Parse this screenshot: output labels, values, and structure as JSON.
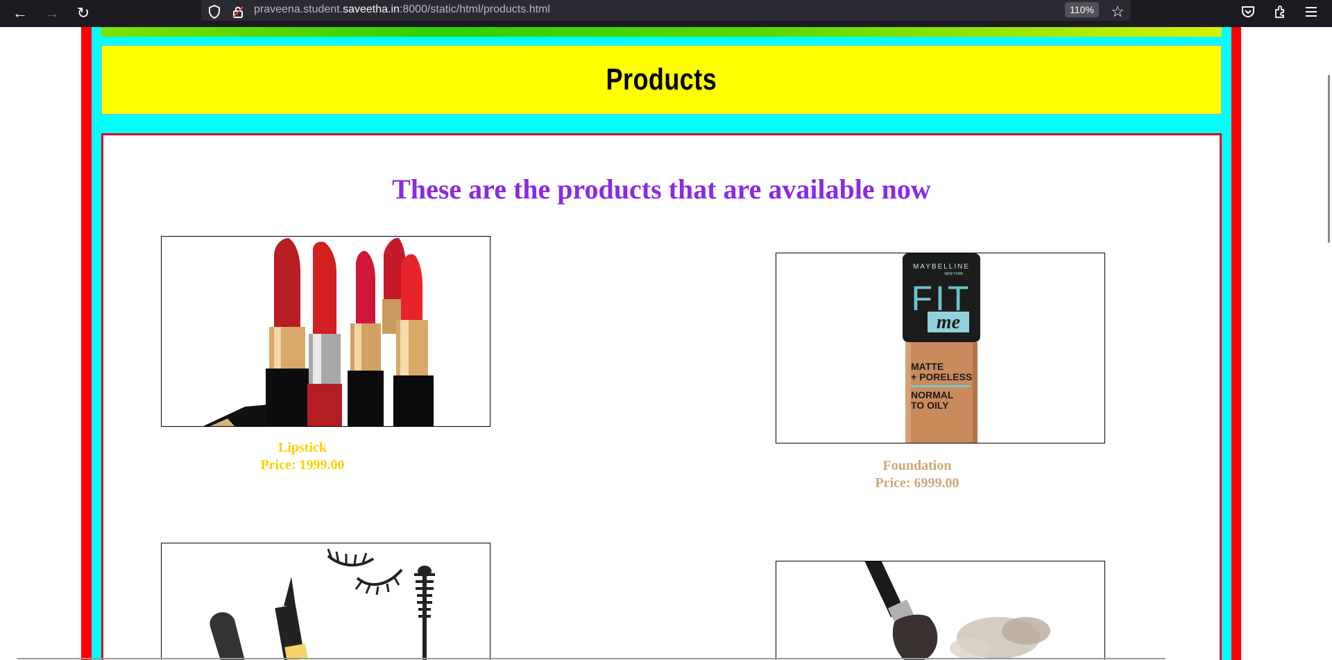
{
  "browser": {
    "url_prefix": "praveena.student.",
    "url_domain": "saveetha.in",
    "url_suffix": ":8000/static/html/products.html",
    "zoom": "110%"
  },
  "page": {
    "title": "Products",
    "subtitle": "These are the products that are available now"
  },
  "products": [
    {
      "name": "Lipstick",
      "price": "Price: 1999.00",
      "color": "#ffd000"
    },
    {
      "name": "Foundation",
      "price": "Price: 6999.00",
      "color": "#d2a679"
    }
  ],
  "foundation_label": {
    "brand": "MAYBELLINE",
    "brand_sub": "NEW YORK",
    "fit": "FIT",
    "me": "me",
    "line1": "MATTE",
    "line2": "+ PORELESS",
    "line3": "NORMAL",
    "line4": "TO OILY"
  },
  "colors": {
    "outer_border": "#ff0000",
    "frame": "#00ffff",
    "header_bg": "#ffff00",
    "subtitle": "#8a2be2"
  }
}
